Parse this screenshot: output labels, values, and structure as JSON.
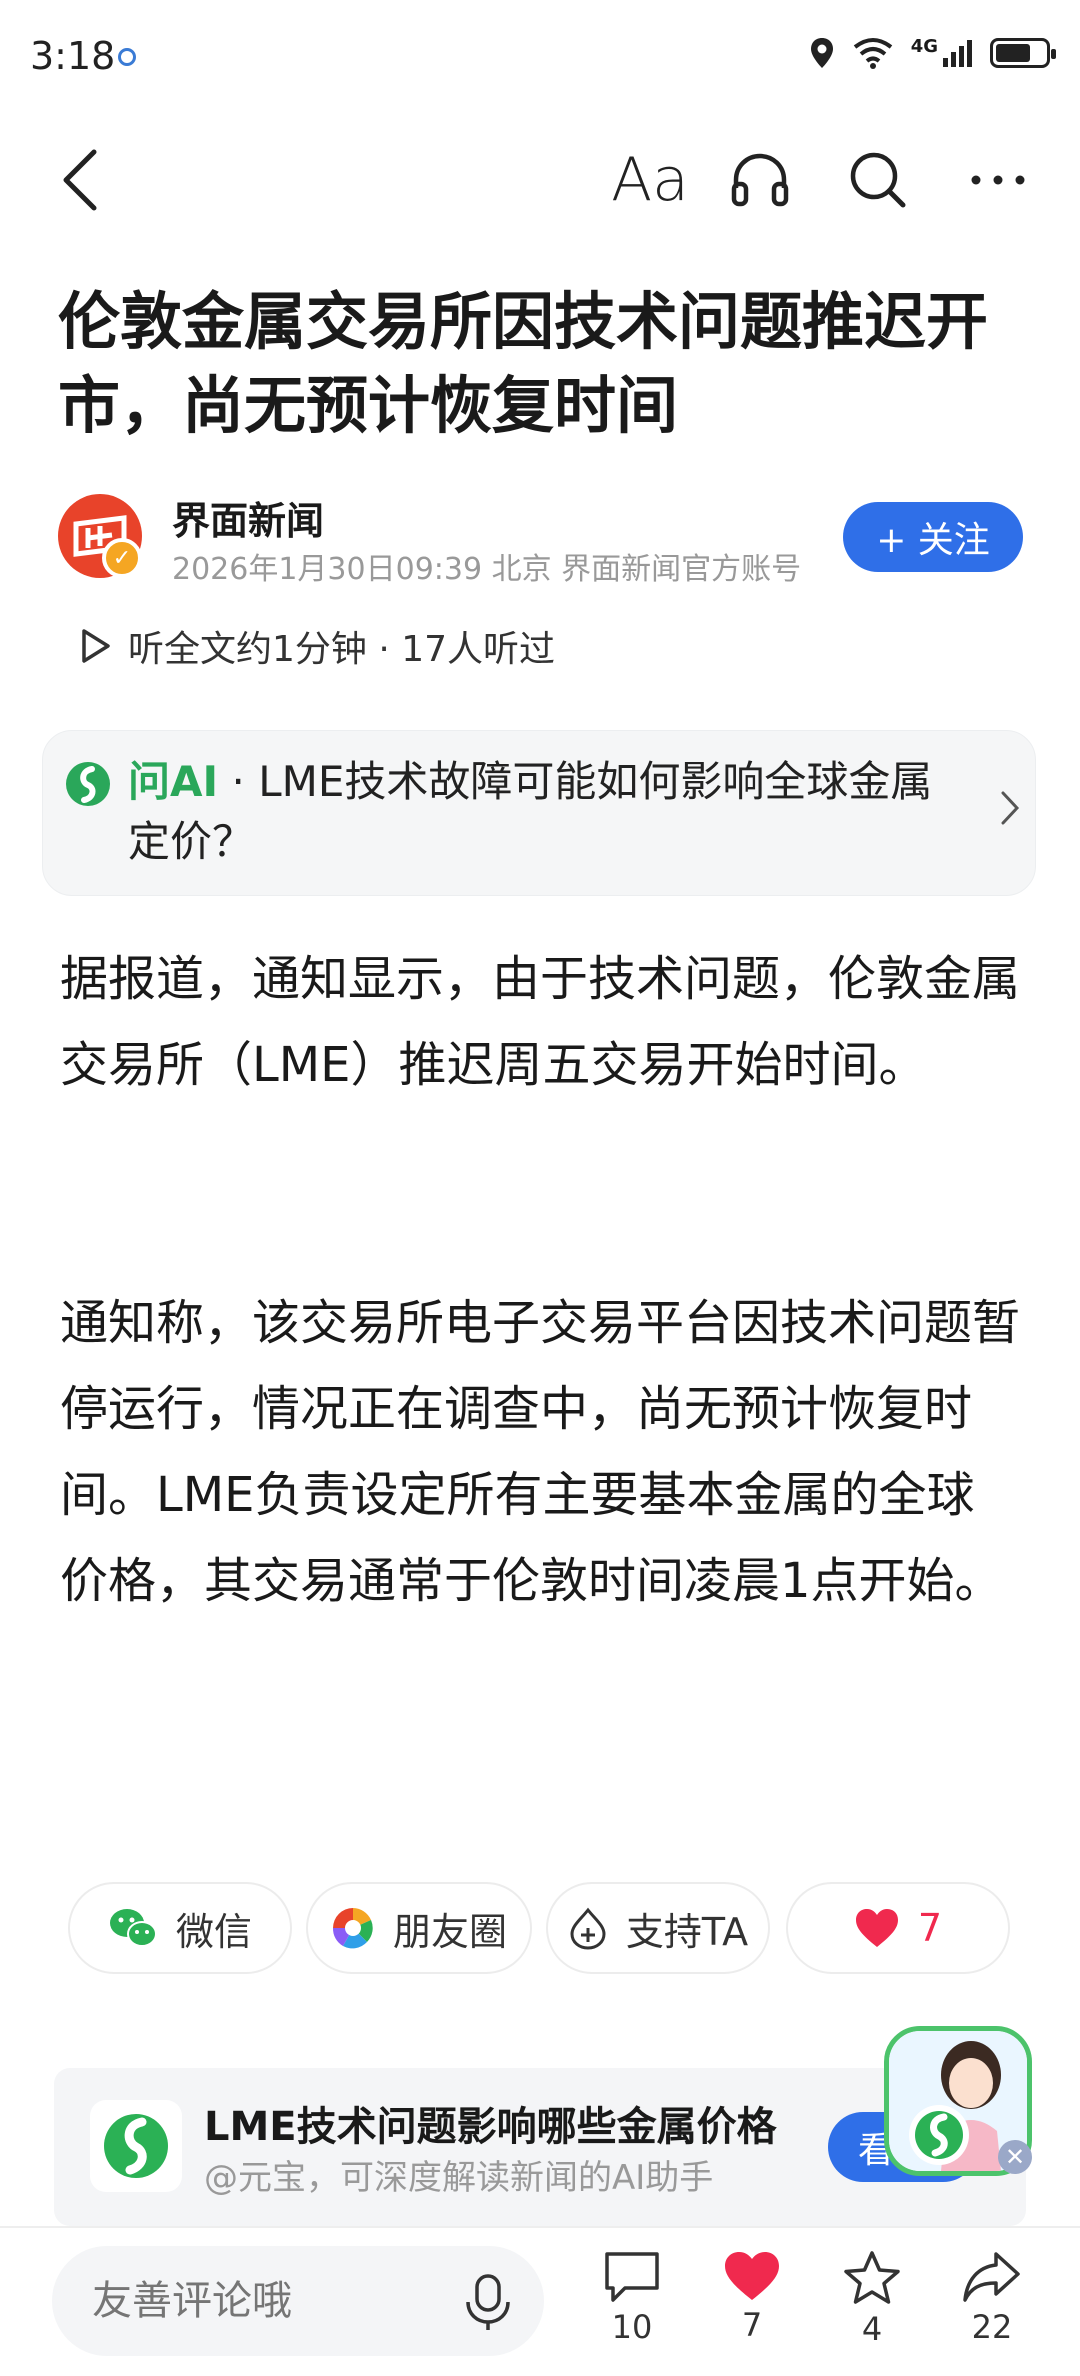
{
  "status": {
    "time": "3:18",
    "network": "4G"
  },
  "nav": {
    "font_label": "Aa"
  },
  "article": {
    "title": "伦敦金属交易所因技术问题推迟开市，尚无预计恢复时间",
    "paragraphs": [
      "据报道，通知显示，由于技术问题，伦敦金属交易所（LME）推迟周五交易开始时间。",
      "通知称，该交易所电子交易平台因技术问题暂停运行，情况正在调查中，尚无预计恢复时间。LME负责设定所有主要基本金属的全球价格，其交易通常于伦敦时间凌晨1点开始。"
    ]
  },
  "author": {
    "name": "界面新闻",
    "meta": "2026年1月30日09:39 北京 界面新闻官方账号",
    "follow_label": "+ 关注"
  },
  "listen": {
    "text": "听全文约1分钟 · 17人听过"
  },
  "ai_box": {
    "label": "问AI",
    "question": " · LME技术故障可能如何影响全球金属定价？"
  },
  "share": {
    "wechat": "微信",
    "moments": "朋友圈",
    "support": "支持TA",
    "likes": "7"
  },
  "promo": {
    "title": "LME技术问题影响哪些金属价格",
    "subtitle": "@元宝，可深度解读新闻的AI助手",
    "button": "看"
  },
  "bottom_bar": {
    "comment_placeholder": "友善评论哦",
    "comments": "10",
    "likes": "7",
    "favorites": "4",
    "shares": "22"
  },
  "colors": {
    "accent": "#2f6fe8",
    "like": "#f0294e",
    "ai_green": "#2aa75a",
    "avatar_red": "#e8432a"
  }
}
